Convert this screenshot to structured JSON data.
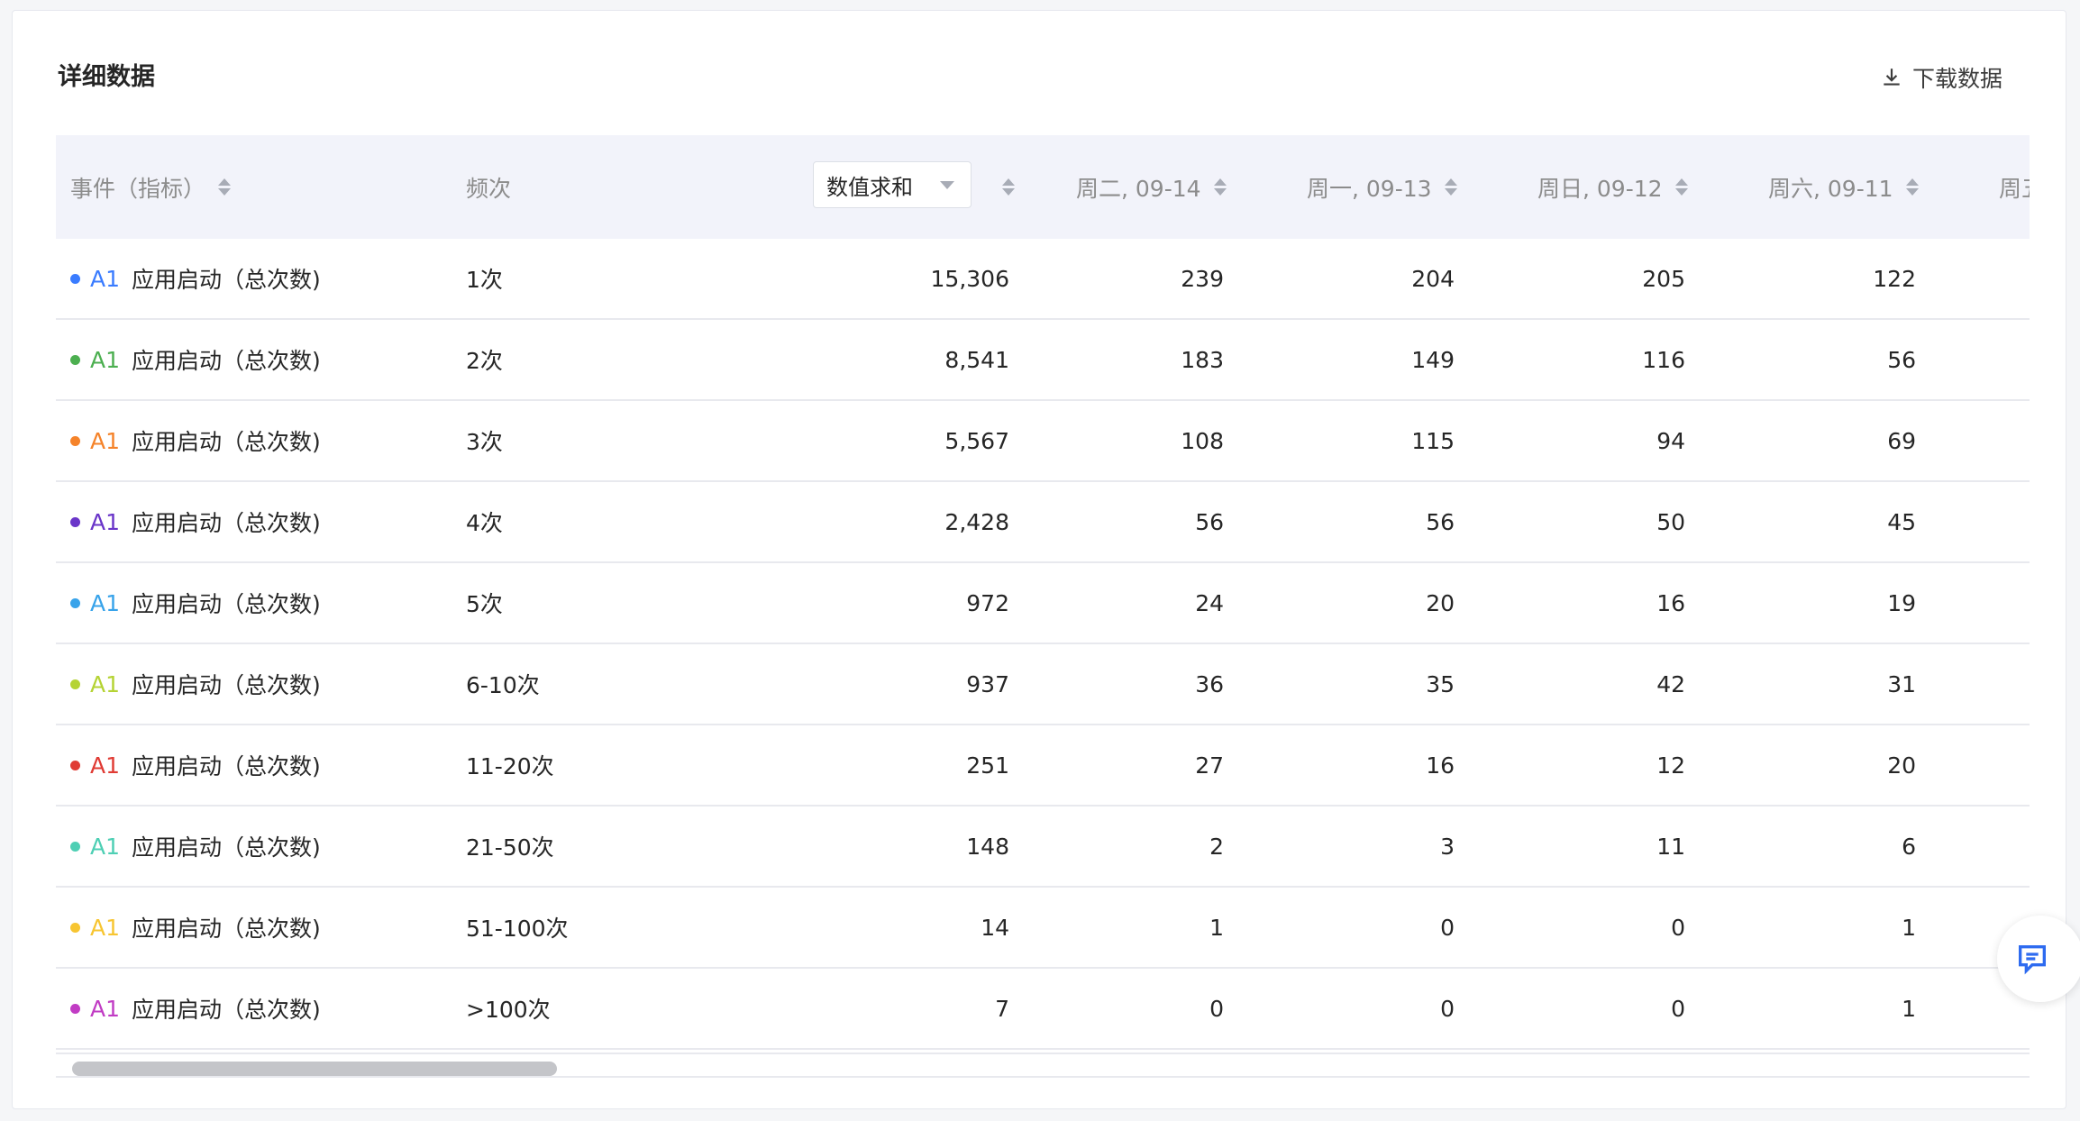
{
  "title": "详细数据",
  "download_label": "下载数据",
  "header": {
    "event_col": "事件（指标）",
    "freq_col": "频次",
    "agg_select": "数值求和",
    "date_cols": [
      "周二, 09-14",
      "周一, 09-13",
      "周日, 09-12",
      "周六, 09-11",
      "周五"
    ]
  },
  "rows": [
    {
      "tag": "A1",
      "event": "应用启动（总次数)",
      "color": "#3a7cff",
      "freq": "1次",
      "total": "15,306",
      "d1": "239",
      "d2": "204",
      "d3": "205",
      "d4": "122"
    },
    {
      "tag": "A1",
      "event": "应用启动（总次数)",
      "color": "#4caf50",
      "freq": "2次",
      "total": "8,541",
      "d1": "183",
      "d2": "149",
      "d3": "116",
      "d4": "56"
    },
    {
      "tag": "A1",
      "event": "应用启动（总次数)",
      "color": "#f5832a",
      "freq": "3次",
      "total": "5,567",
      "d1": "108",
      "d2": "115",
      "d3": "94",
      "d4": "69"
    },
    {
      "tag": "A1",
      "event": "应用启动（总次数)",
      "color": "#6a35c9",
      "freq": "4次",
      "total": "2,428",
      "d1": "56",
      "d2": "56",
      "d3": "50",
      "d4": "45"
    },
    {
      "tag": "A1",
      "event": "应用启动（总次数)",
      "color": "#38a3ea",
      "freq": "5次",
      "total": "972",
      "d1": "24",
      "d2": "20",
      "d3": "16",
      "d4": "19"
    },
    {
      "tag": "A1",
      "event": "应用启动（总次数)",
      "color": "#b5d334",
      "freq": "6-10次",
      "total": "937",
      "d1": "36",
      "d2": "35",
      "d3": "42",
      "d4": "31"
    },
    {
      "tag": "A1",
      "event": "应用启动（总次数)",
      "color": "#e03b34",
      "freq": "11-20次",
      "total": "251",
      "d1": "27",
      "d2": "16",
      "d3": "12",
      "d4": "20"
    },
    {
      "tag": "A1",
      "event": "应用启动（总次数)",
      "color": "#4ecfb4",
      "freq": "21-50次",
      "total": "148",
      "d1": "2",
      "d2": "3",
      "d3": "11",
      "d4": "6"
    },
    {
      "tag": "A1",
      "event": "应用启动（总次数)",
      "color": "#f7c531",
      "freq": "51-100次",
      "total": "14",
      "d1": "1",
      "d2": "0",
      "d3": "0",
      "d4": "1"
    },
    {
      "tag": "A1",
      "event": "应用启动（总次数)",
      "color": "#c13cc4",
      "freq": ">100次",
      "total": "7",
      "d1": "0",
      "d2": "0",
      "d3": "0",
      "d4": "1"
    }
  ],
  "icons": {
    "download": "download-icon",
    "feedback": "feedback-icon",
    "sort": "sort-icon"
  }
}
